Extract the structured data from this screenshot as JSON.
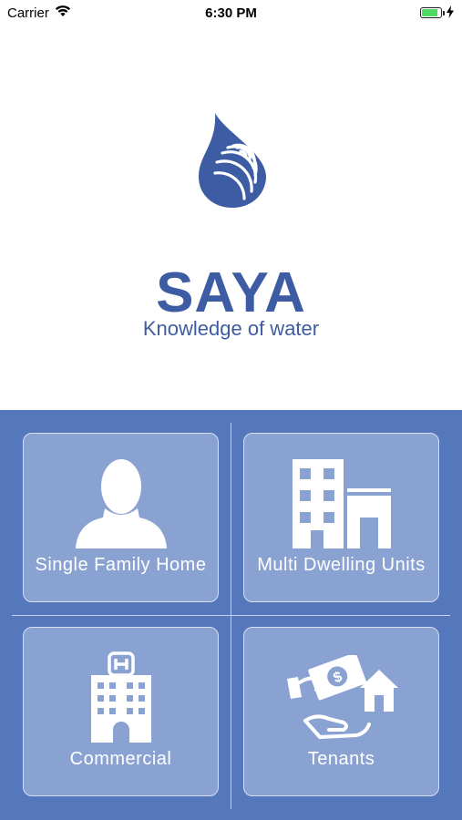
{
  "status_bar": {
    "carrier": "Carrier",
    "time": "6:30 PM"
  },
  "app": {
    "brand_name": "SAYA",
    "tagline": "Knowledge of water"
  },
  "tiles": [
    {
      "label": "Single Family Home",
      "icon": "person-icon"
    },
    {
      "label": "Multi Dwelling Units",
      "icon": "building-icon"
    },
    {
      "label": "Commercial",
      "icon": "hospital-icon"
    },
    {
      "label": "Tenants",
      "icon": "rent-payment-icon"
    }
  ],
  "colors": {
    "brand": "#3d5ca3",
    "grid_background": "#5577bb",
    "tile_background": "#8aa2d2"
  }
}
